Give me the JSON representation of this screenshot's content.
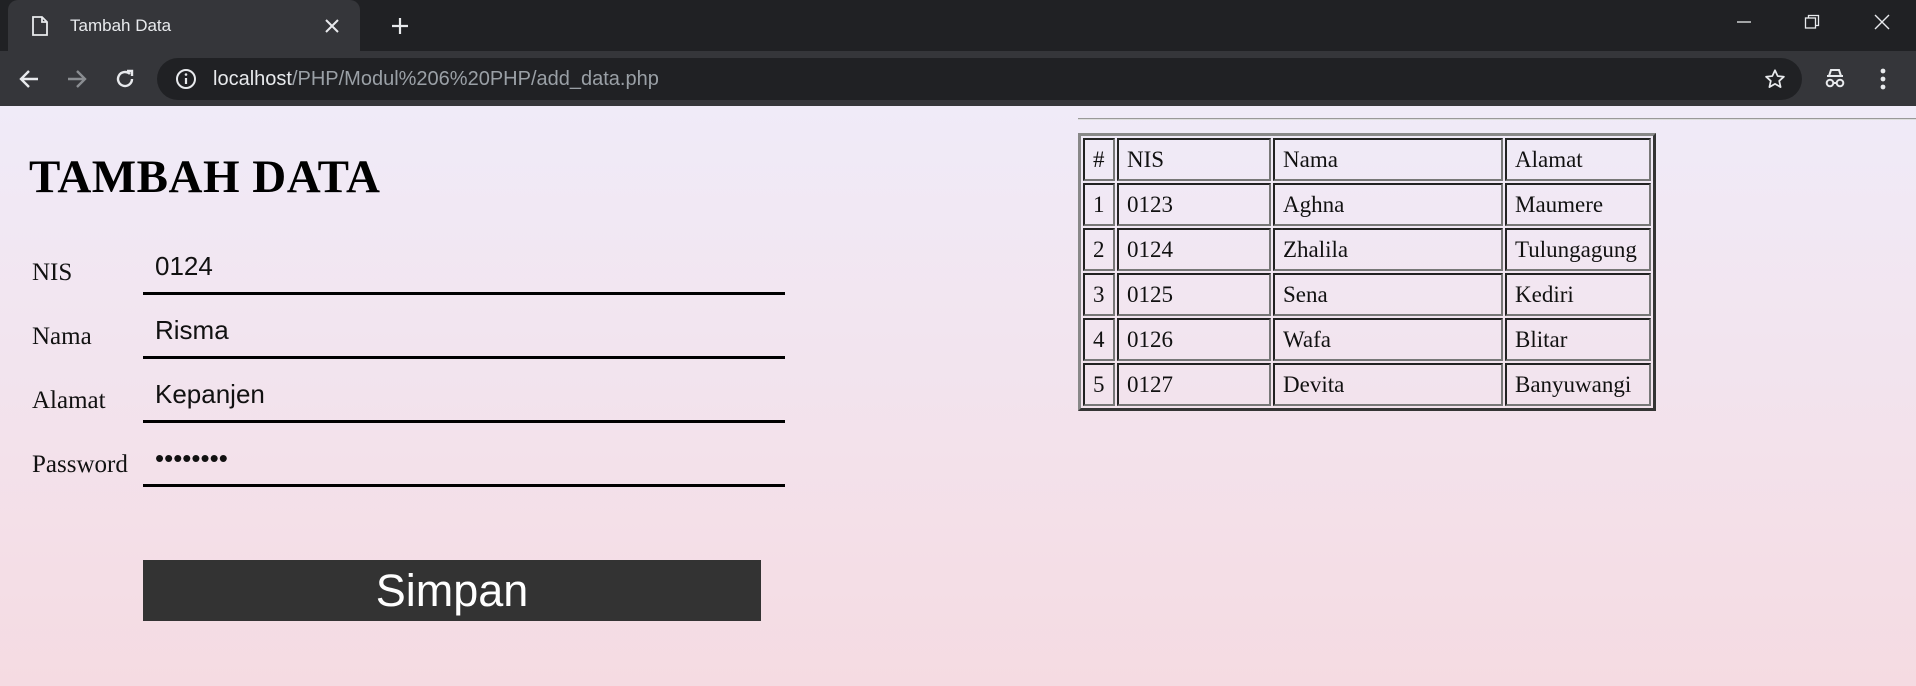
{
  "browser": {
    "tab_title": "Tambah Data",
    "url_host": "localhost",
    "url_path": "/PHP/Modul%206%20PHP/add_data.php"
  },
  "form": {
    "heading": "TAMBAH DATA",
    "fields": [
      {
        "label": "NIS",
        "value": "0124"
      },
      {
        "label": "Nama",
        "value": "Risma"
      },
      {
        "label": "Alamat",
        "value": "Kepanjen"
      },
      {
        "label": "Password",
        "value": "••••••••"
      }
    ],
    "submit_label": "Simpan"
  },
  "table": {
    "headers": [
      "#",
      "NIS",
      "Nama",
      "Alamat"
    ],
    "rows": [
      [
        "1",
        "0123",
        "Aghna",
        "Maumere"
      ],
      [
        "2",
        "0124",
        "Zhalila",
        "Tulungagung"
      ],
      [
        "3",
        "0125",
        "Sena",
        "Kediri"
      ],
      [
        "4",
        "0126",
        "Wafa",
        "Blitar"
      ],
      [
        "5",
        "0127",
        "Devita",
        "Banyuwangi"
      ]
    ]
  }
}
